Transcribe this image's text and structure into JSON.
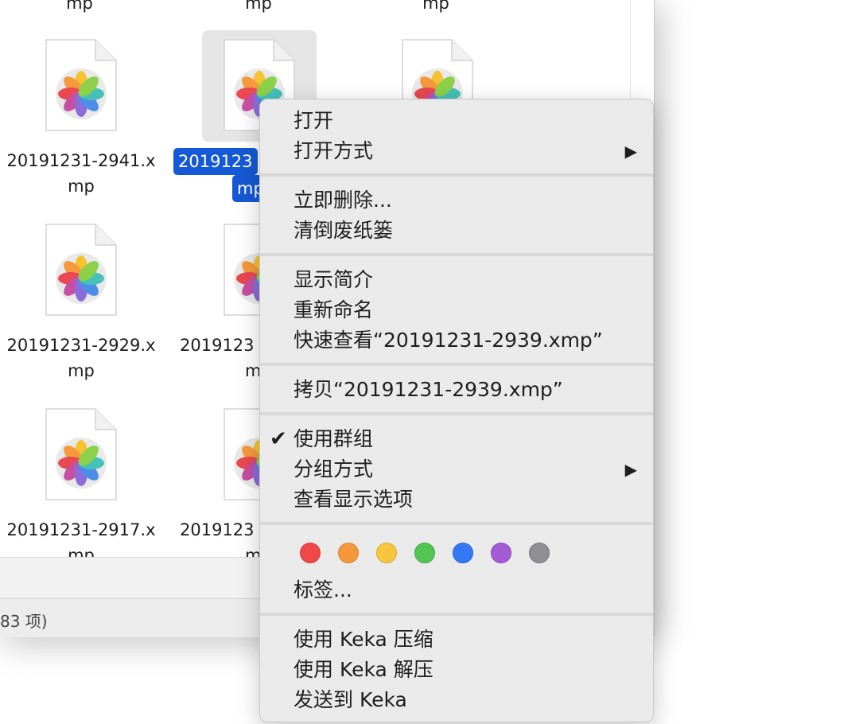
{
  "finder": {
    "top_labels": [
      "mp",
      "mp",
      "mp"
    ],
    "files": [
      {
        "line1": "20191231-2941.x",
        "line2": "mp"
      },
      {
        "line1": "2019123",
        "line2": "mp"
      },
      {
        "line1": "20191231-2929.x",
        "line2": "mp"
      },
      {
        "line1": "2019123",
        "line2": "m"
      },
      {
        "line1": "20191231-2917.x",
        "line2": "mp"
      },
      {
        "line1": "2019123",
        "line2": "m"
      }
    ],
    "status_text": "83 项)"
  },
  "context_menu": {
    "items": {
      "open": "打开",
      "open_with": "打开方式",
      "delete_now": "立即删除...",
      "empty_trash": "清倒废纸篓",
      "get_info": "显示简介",
      "rename": "重新命名",
      "quick_look": "快速查看“20191231-2939.xmp”",
      "copy": "拷贝“20191231-2939.xmp”",
      "use_groups": "使用群组",
      "group_by": "分组方式",
      "show_view_options": "查看显示选项",
      "tags": "标签...",
      "keka_compress": "使用 Keka 压缩",
      "keka_extract": "使用 Keka 解压",
      "send_to_keka": "发送到 Keka"
    },
    "submenu_arrow": "▶",
    "checkmark": "✔",
    "tag_colors": [
      "#f04848",
      "#f3983c",
      "#f6c73e",
      "#52c553",
      "#3478f6",
      "#a55ad6",
      "#8e8e93"
    ]
  },
  "icons": {
    "file_icon": "photos-document-icon",
    "submenu": "chevron-right-icon",
    "check": "checkmark-icon"
  }
}
